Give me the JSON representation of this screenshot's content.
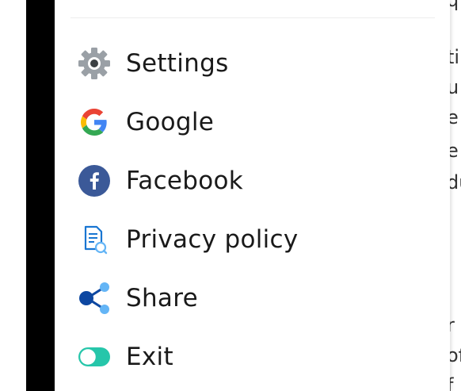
{
  "menu": {
    "items": [
      {
        "label": "Settings",
        "icon": "gear-icon"
      },
      {
        "label": "Google",
        "icon": "google-icon"
      },
      {
        "label": "Facebook",
        "icon": "facebook-icon"
      },
      {
        "label": "Privacy policy",
        "icon": "privacy-policy-icon"
      },
      {
        "label": "Share",
        "icon": "share-icon"
      },
      {
        "label": "Exit",
        "icon": "toggle-icon"
      }
    ]
  },
  "background_text": {
    "fragments": [
      "q",
      "ti",
      "u",
      "e",
      "e",
      "du",
      "r",
      "of",
      "f"
    ]
  },
  "colors": {
    "gear": "#9aa0a6",
    "facebook": "#3b5998",
    "privacy": "#1976d2",
    "share_dark": "#0d47a1",
    "share_light": "#64b5f6",
    "toggle": "#26c6aa"
  }
}
